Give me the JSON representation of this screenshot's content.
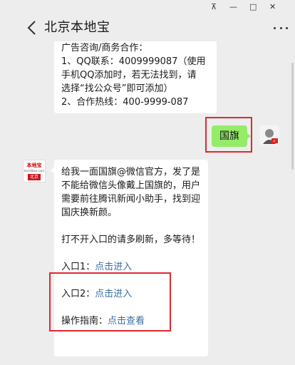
{
  "window": {
    "pin": "⊼",
    "minimize": "—",
    "maximize": "□",
    "close": "✕"
  },
  "header": {
    "title": "北京本地宝"
  },
  "messages": {
    "first": {
      "line1": "广告咨询/商务合作：",
      "line2": "1、QQ联系：4009999087（使用",
      "line3": "手机QQ添加时，若无法找到，请",
      "line4": "选择“找公众号”即可添加）",
      "line5": "2、合作热线：400-9999-087"
    },
    "user": {
      "text": "国旗"
    },
    "bot": {
      "avatar_top": "本地宝",
      "avatar_mid": "bendibao.com",
      "avatar_bottom": "北京",
      "para1": "给我一面国旗@微信官方，发了是不能给微信头像戴上国旗的，用户需要前往腾讯新闻小助手，找到迎国庆换新颜。",
      "para2": "打不开入口的请多刷新，多等待！",
      "entry1_label": "入口1：",
      "entry1_link": "点击进入",
      "entry2_label": "入口2：",
      "entry2_link": "点击进入",
      "guide_label": "操作指南：",
      "guide_link": "点击查看"
    }
  },
  "colors": {
    "highlight": "#e0282e",
    "user_bubble": "#95ec69",
    "link": "#3a6ea5"
  }
}
